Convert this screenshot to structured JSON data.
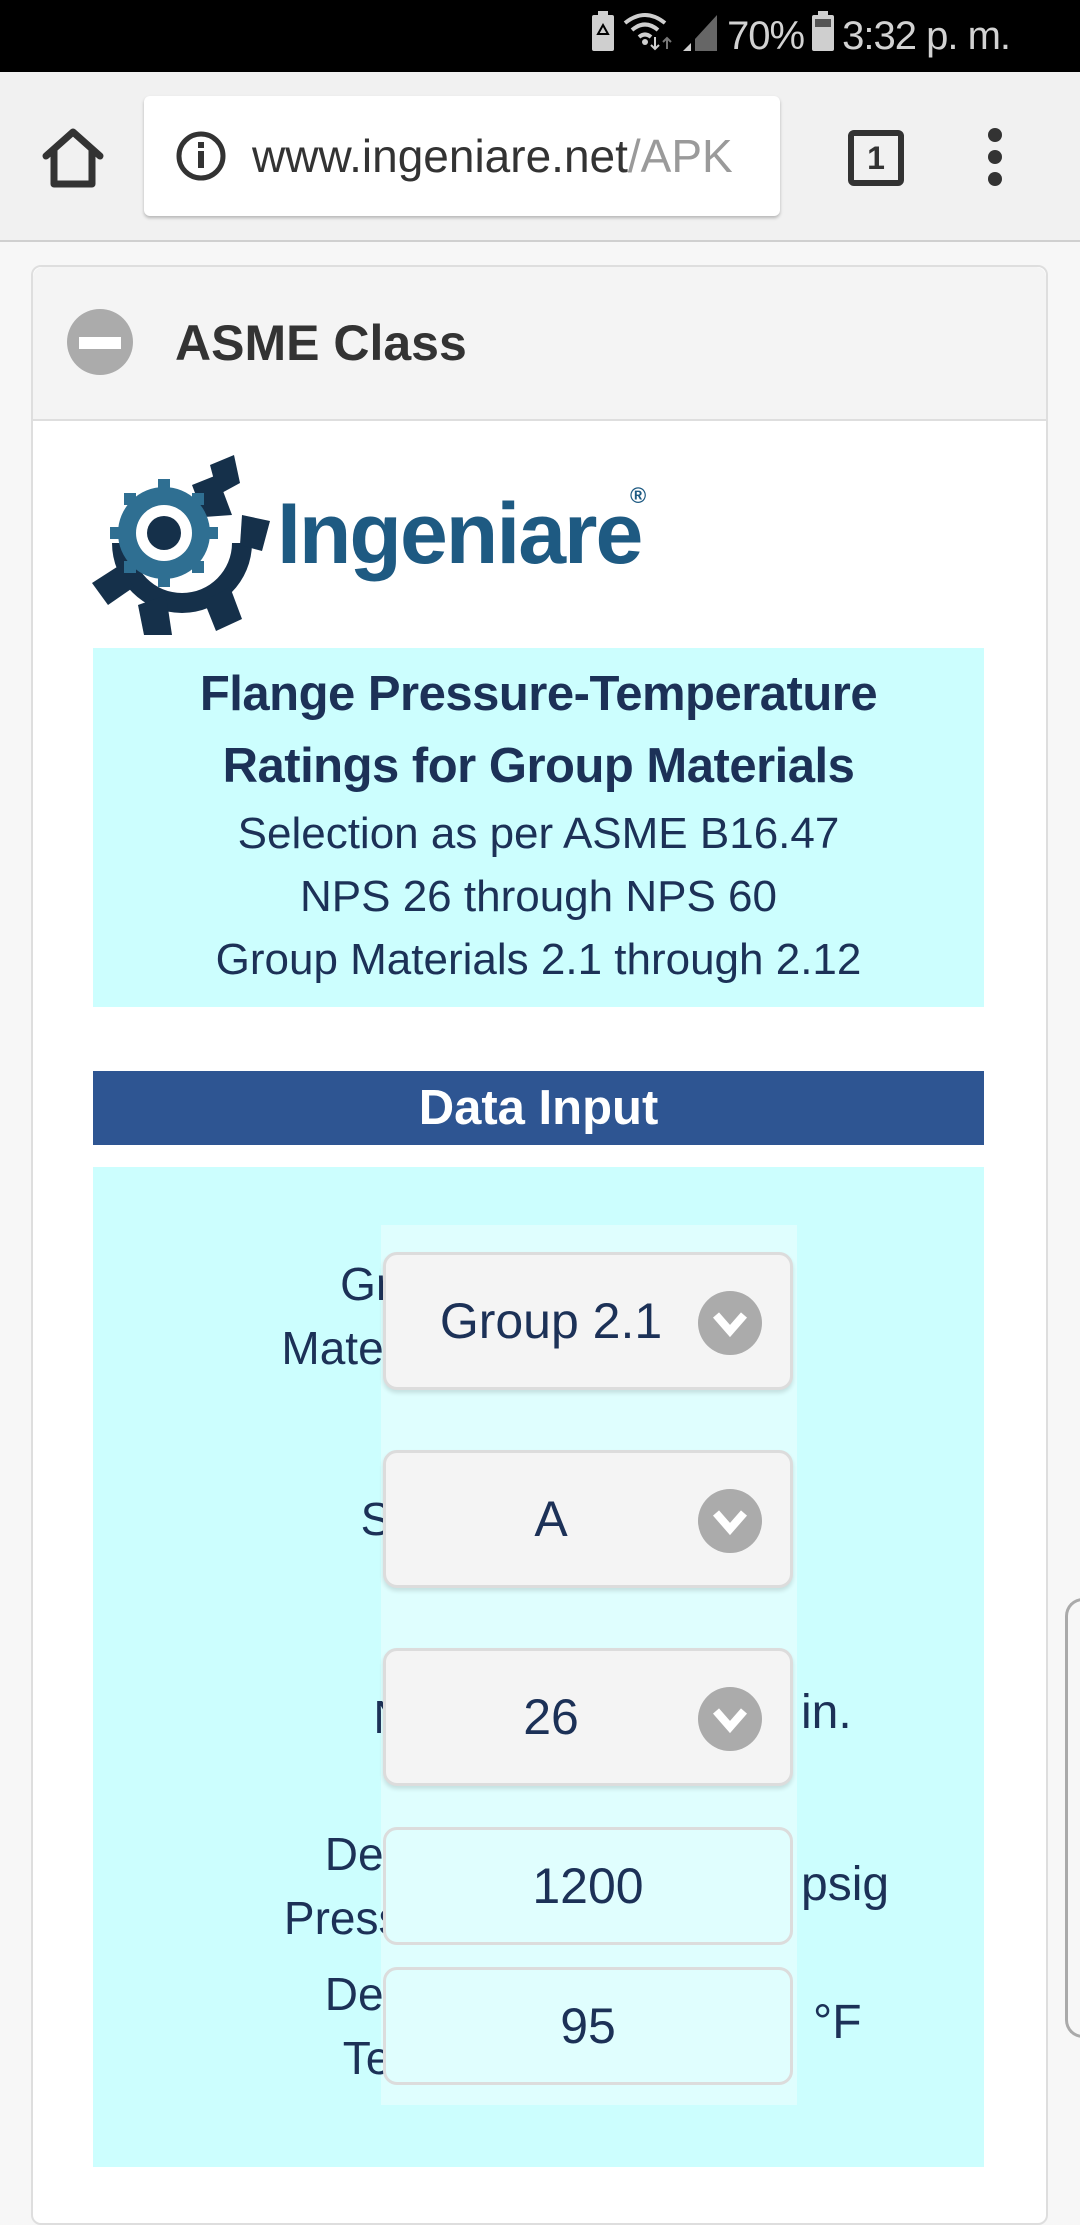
{
  "status_bar": {
    "battery_percent": "70%",
    "time": "3:32 p. m.",
    "icons": [
      "battery-saver-icon",
      "wifi-icon",
      "signal-icon",
      "battery-icon"
    ]
  },
  "browser": {
    "url_domain": "www.ingeniare.net",
    "url_path": "/APK",
    "tab_count": "1"
  },
  "card": {
    "title": "ASME Class"
  },
  "logo": {
    "text": "Ingeniare",
    "registered": "®"
  },
  "info": {
    "title_line1": "Flange Pressure-Temperature",
    "title_line2": "Ratings for Group Materials",
    "line1": "Selection as per ASME B16.47",
    "line2": "NPS 26 through NPS 60",
    "line3": "Group Materials 2.1 through 2.12"
  },
  "data_input": {
    "section_title": "Data Input",
    "group_materials": {
      "label_line1": "Group",
      "label_line2": "Materials",
      "value": "Group 2.1"
    },
    "serie": {
      "label": "Serie",
      "value": "A"
    },
    "nps": {
      "label": "NPS",
      "value": "26",
      "unit": "in."
    },
    "design_pressure": {
      "label_line1": "Design",
      "label_line2": "Pressure",
      "value": "1200",
      "unit": "psig"
    },
    "design_temp": {
      "label_line1": "Design",
      "label_line2": "Temp.",
      "value": "95",
      "unit": "°F"
    }
  },
  "colors": {
    "section_bar": "#2e5592",
    "info_bg": "#ccfefe",
    "text_dark": "#1c3157",
    "logo_blue": "#1e5a82"
  }
}
